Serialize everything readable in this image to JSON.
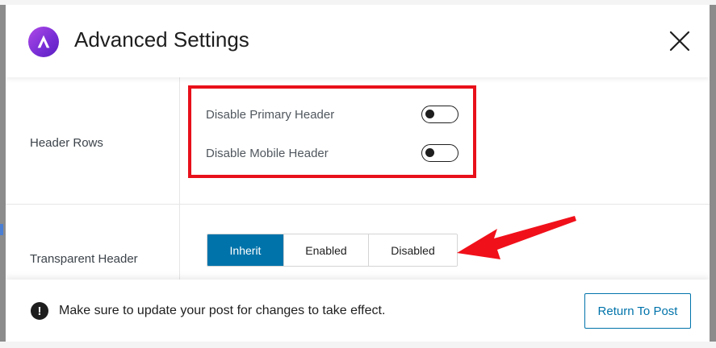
{
  "modal": {
    "title": "Advanced Settings",
    "close_icon": "close-icon",
    "logo_icon": "astra-logo-icon"
  },
  "header_rows": {
    "label": "Header Rows",
    "toggles": [
      {
        "label": "Disable Primary Header",
        "checked": false
      },
      {
        "label": "Disable Mobile Header",
        "checked": false
      }
    ]
  },
  "transparent_header": {
    "label": "Transparent Header",
    "options": [
      "Inherit",
      "Enabled",
      "Disabled"
    ],
    "selected": "Inherit"
  },
  "footer": {
    "notice_icon": "exclamation-circle-icon",
    "notice_text": "Make sure to update your post for changes to take effect.",
    "return_button": "Return To Post"
  },
  "colors": {
    "accent": "#0073aa",
    "highlight": "#e8101a",
    "logo": "#7a2fd6"
  }
}
